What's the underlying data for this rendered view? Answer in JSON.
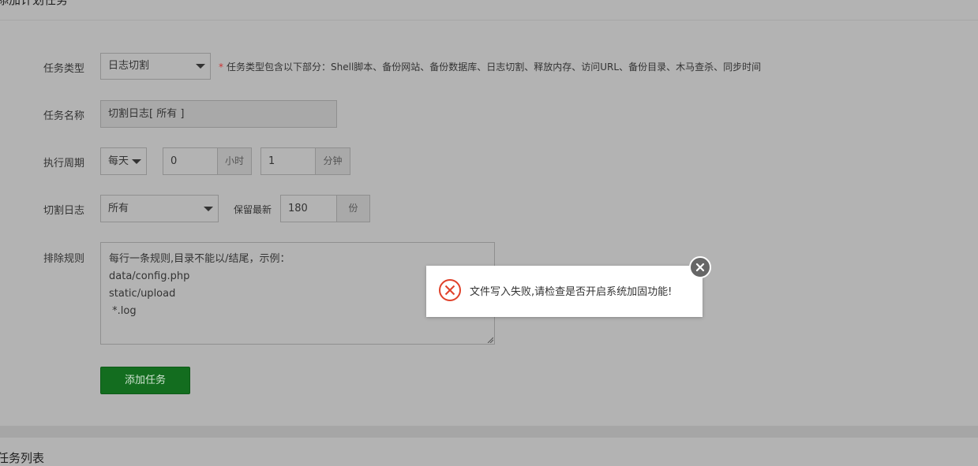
{
  "header": {
    "title": "添加计划任务"
  },
  "form": {
    "task_type": {
      "label": "任务类型",
      "value": "日志切割",
      "hint_star": "*",
      "hint": "任务类型包含以下部分：Shell脚本、备份网站、备份数据库、日志切割、释放内存、访问URL、备份目录、木马查杀、同步时间"
    },
    "task_name": {
      "label": "任务名称",
      "value": "切割日志[ 所有 ]"
    },
    "period": {
      "label": "执行周期",
      "cycle": "每天",
      "hour_value": "0",
      "hour_unit": "小时",
      "minute_value": "1",
      "minute_unit": "分钟"
    },
    "cut_log": {
      "label": "切割日志",
      "value": "所有",
      "keep_label": "保留最新",
      "keep_value": "180",
      "keep_unit": "份"
    },
    "exclude": {
      "label": "排除规则",
      "lines": [
        "每行一条规则,目录不能以/结尾，示例：",
        "data/config.php",
        "static/upload",
        " *.log"
      ]
    },
    "submit_label": "添加任务"
  },
  "section": {
    "title": "任务列表"
  },
  "toast": {
    "message": "文件写入失败,请检查是否开启系统加固功能!",
    "icon": "error-circle-icon",
    "close_icon": "close-icon"
  },
  "colors": {
    "submit_bg": "#136d1f",
    "error": "#e0412a",
    "overlay": "#b3b3b3"
  }
}
